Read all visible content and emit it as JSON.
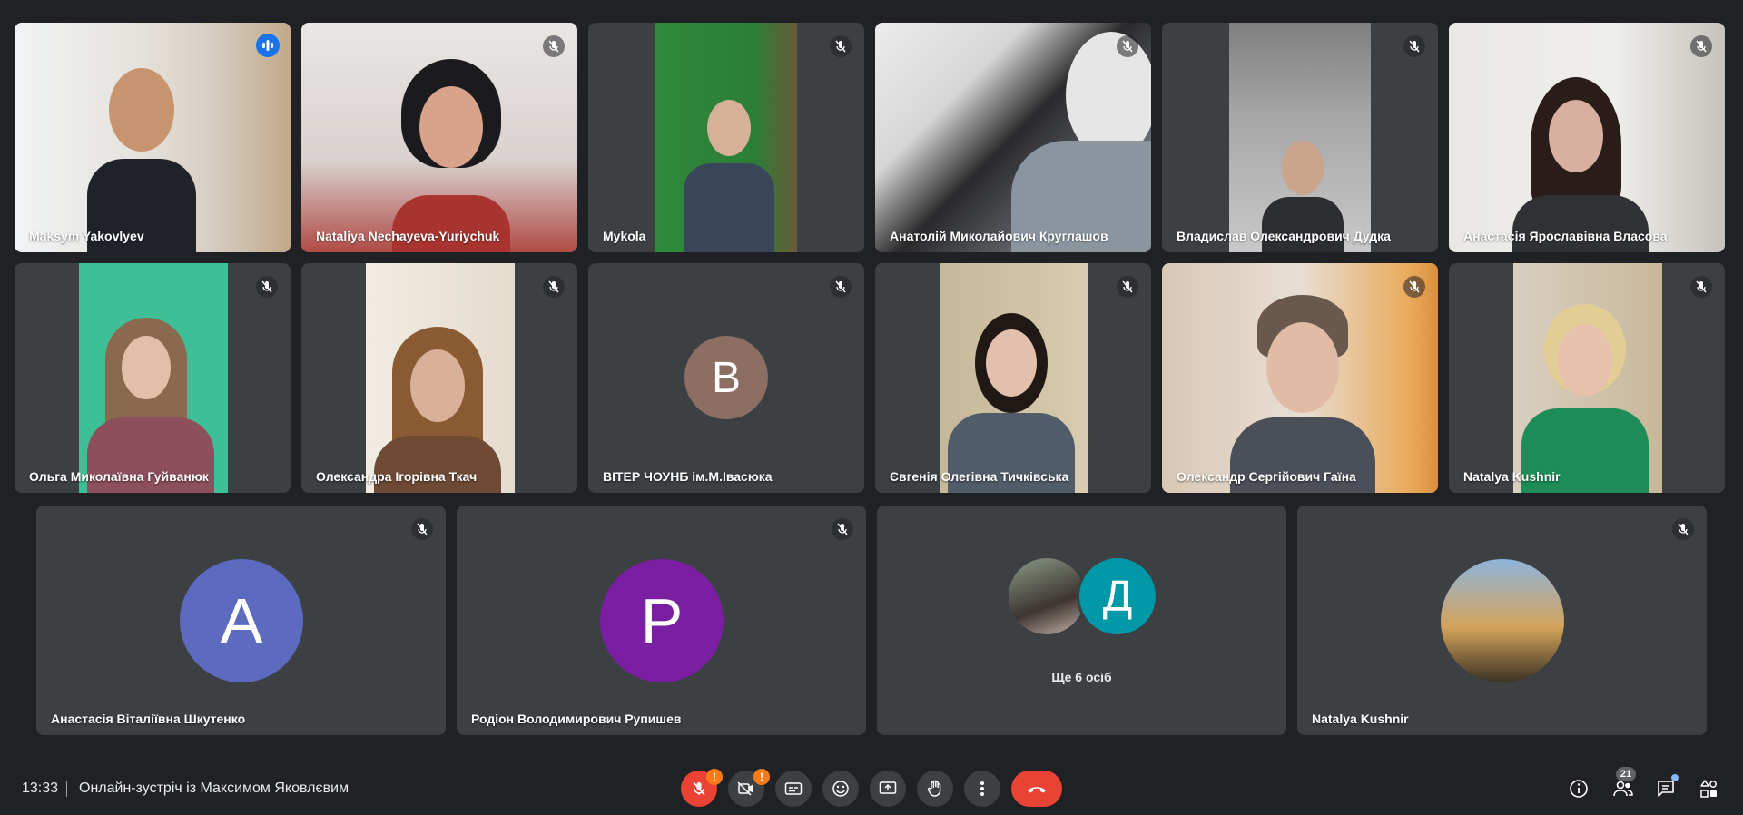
{
  "participants_row1": [
    {
      "name": "Maksym Yakovlyev",
      "state": "speaking"
    },
    {
      "name": "Nataliya Nechayeva-Yuriychuk",
      "state": "muted"
    },
    {
      "name": "Mykola",
      "state": "muted"
    },
    {
      "name": "Анатолій Миколайович Круглашов",
      "state": "muted"
    },
    {
      "name": "Владислав Олександрович Дудка",
      "state": "muted"
    },
    {
      "name": "Анастасія Ярославівна Власова",
      "state": "muted"
    }
  ],
  "participants_row2": [
    {
      "name": "Ольга Миколаївна Гуйванюк",
      "state": "muted"
    },
    {
      "name": "Олександра Ігорівна Ткач",
      "state": "muted"
    },
    {
      "name": "ВІТЕР ЧОУНБ ім.М.Івасюка",
      "state": "muted",
      "avatar_letter": "В"
    },
    {
      "name": "Євгенія Олегівна Тичківська",
      "state": "muted"
    },
    {
      "name": "Олександр Сергійович Гаїна",
      "state": "muted"
    },
    {
      "name": "Natalya Kushnir",
      "state": "muted"
    }
  ],
  "participants_row3": [
    {
      "name": "Анастасія Віталіївна Шкутенко",
      "state": "muted",
      "avatar_letter": "А"
    },
    {
      "name": "Родіон Володимирович Рупишев",
      "state": "muted",
      "avatar_letter": "Р"
    },
    {
      "more_label": "Ще 6 осіб",
      "avatar_letter": "Д"
    },
    {
      "name": "Natalya Kushnir",
      "state": "muted"
    }
  ],
  "colors": {
    "avatar_v": "#8d6e63",
    "avatar_a": "#5c6bc0",
    "avatar_r": "#7b1fa2",
    "avatar_d": "#0097a7",
    "end_call": "#ea4335",
    "warning": "#fa7b17"
  },
  "bottom_bar": {
    "time": "13:33",
    "meeting_title": "Онлайн-зустріч із Максимом Яковлєвим",
    "controls": [
      {
        "icon": "mic-off-icon",
        "warning_badge": "!"
      },
      {
        "icon": "camera-off-icon",
        "warning_badge": "!"
      },
      {
        "icon": "captions-icon"
      },
      {
        "icon": "emoji-icon"
      },
      {
        "icon": "present-screen-icon"
      },
      {
        "icon": "raise-hand-icon"
      },
      {
        "icon": "more-options-icon"
      },
      {
        "icon": "end-call-icon"
      }
    ],
    "right_controls": [
      {
        "icon": "info-icon"
      },
      {
        "icon": "people-icon",
        "badge": "21"
      },
      {
        "icon": "chat-icon"
      },
      {
        "icon": "activities-icon"
      }
    ]
  }
}
